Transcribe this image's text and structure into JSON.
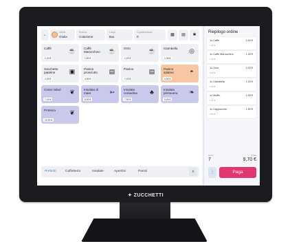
{
  "brand": "ZUCCHETTI",
  "header": {
    "back_icon": "arrow-left-icon",
    "user_label": "Utente",
    "user_value": "Giulia",
    "service_label": "Servizio",
    "service_value": "Colazione",
    "location_label": "Luogo",
    "location_value": "Bar",
    "covers_label": "Coperti/persone",
    "covers_value": "0",
    "icons": [
      "print-icon",
      "calculator-icon",
      "gear-icon"
    ]
  },
  "products": [
    {
      "name": "Caffè",
      "price": "1,20 €",
      "color": "grey",
      "icon": "cup-icon",
      "glyph": "☕"
    },
    {
      "name": "Caffè Marocchino",
      "price": "1,50 €",
      "color": "grey",
      "icon": "cup-icon",
      "glyph": "☕"
    },
    {
      "name": "Orzo",
      "price": "2,00 €",
      "color": "grey",
      "icon": "mug-icon",
      "glyph": "☕"
    },
    {
      "name": "Ciambella",
      "price": "1,30 €",
      "color": "grey",
      "icon": "donut-icon",
      "glyph": "◎"
    },
    {
      "name": "Sacchetto patatine",
      "price": "2,00 €",
      "color": "grey",
      "icon": "chips-bag-icon",
      "glyph": "▣"
    },
    {
      "name": "Panino prosciutto",
      "price": "4,50 €",
      "color": "grey",
      "icon": "sandwich-icon",
      "glyph": "▤"
    },
    {
      "name": "Panino",
      "price": "7,00 €",
      "color": "grey",
      "icon": "sandwich-icon",
      "glyph": "▤"
    },
    {
      "name": "Panino salame",
      "price": "4,50 €",
      "color": "orange",
      "icon": "bread-icon",
      "glyph": "◓"
    },
    {
      "name": "Cesar salad",
      "price": "7,00 €",
      "color": "lav",
      "icon": "salad-icon",
      "glyph": "❦"
    },
    {
      "name": "Insalata di mare",
      "price": "8,50 €",
      "color": "lav",
      "icon": "fish-icon",
      "glyph": "➳"
    },
    {
      "name": "Insalata contadina",
      "price": "7,50 €",
      "color": "lav",
      "icon": "broccoli-icon",
      "glyph": "♣"
    },
    {
      "name": "Insalata primavera",
      "price": "9,00 €",
      "color": "lav",
      "icon": "leaf-icon",
      "glyph": "❧"
    },
    {
      "name": "Proteica",
      "price": "10,00 €",
      "color": "lav",
      "icon": "leaf-icon",
      "glyph": "❦"
    }
  ],
  "categories": [
    "Preferiti",
    "Caffetteria",
    "Insalate",
    "Aperitivi",
    "Panini"
  ],
  "order": {
    "title": "Riepilogo ordine",
    "items": [
      {
        "name": "1x Caffè",
        "price": "2,40 €",
        "sub": "1,20 €"
      },
      {
        "name": "1x Caffè Marocchino",
        "price": "1,30 €",
        "sub": "1,30 €"
      },
      {
        "name": "1x Orzo",
        "price": "2,00 €",
        "sub": "2,00 €"
      },
      {
        "name": "1x Ciambella",
        "price": "1,20 €",
        "sub": "1,20 €"
      },
      {
        "name": "1x Muffin",
        "price": "1,30 €",
        "sub": "1,30 €"
      },
      {
        "name": "1x Cappuccino",
        "price": "1,50 €",
        "sub": "1,50 €"
      }
    ],
    "count_label": "Pezzi",
    "count": "7",
    "total_label": "Totale",
    "total": "9,70 €",
    "pay_label": "Paga",
    "more_glyph": "⋮"
  }
}
